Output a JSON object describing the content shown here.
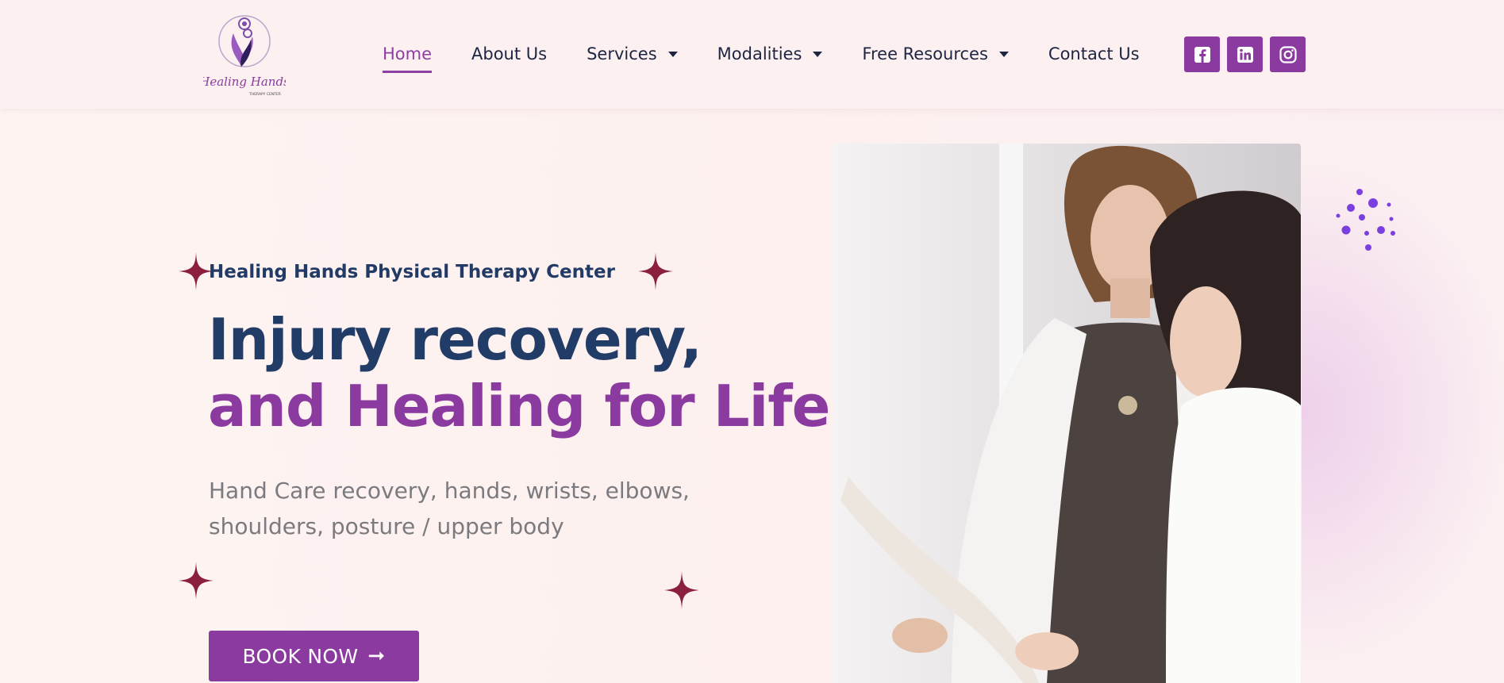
{
  "brand": {
    "name": "Healing Hands",
    "tagline": "THERAPY CENTER",
    "accent_color": "#8b3aa0",
    "navy_color": "#223c68"
  },
  "nav": {
    "items": [
      {
        "label": "Home",
        "active": true,
        "has_dropdown": false
      },
      {
        "label": "About Us",
        "active": false,
        "has_dropdown": false
      },
      {
        "label": "Services",
        "active": false,
        "has_dropdown": true
      },
      {
        "label": "Modalities",
        "active": false,
        "has_dropdown": true
      },
      {
        "label": "Free Resources",
        "active": false,
        "has_dropdown": true
      },
      {
        "label": "Contact Us",
        "active": false,
        "has_dropdown": false
      }
    ]
  },
  "social": [
    {
      "icon": "facebook-square-icon"
    },
    {
      "icon": "linkedin-icon"
    },
    {
      "icon": "instagram-icon"
    }
  ],
  "hero": {
    "eyebrow": "Healing Hands Physical Therapy Center",
    "title_line1": "Injury recovery,",
    "title_line2": "and Healing for Life",
    "subtitle": "Hand Care recovery, hands, wrists, elbows, shoulders, posture / upper body",
    "cta_label": "BOOK NOW",
    "cta_icon": "arrow-right-icon",
    "image_icon": "therapist-with-patient-photo"
  }
}
